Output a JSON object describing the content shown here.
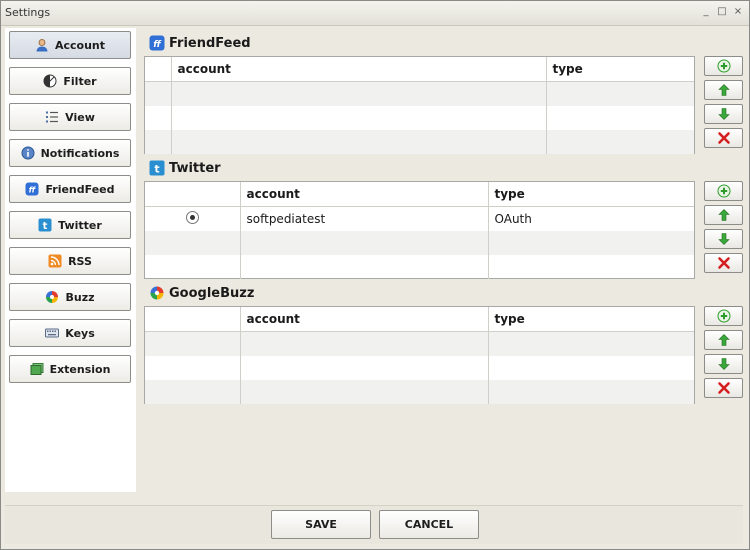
{
  "window": {
    "title": "Settings",
    "minimize": "_",
    "maximize": "□",
    "close": "×"
  },
  "sidebar": {
    "items": [
      {
        "label": "Account",
        "icon": "user-icon",
        "active": true
      },
      {
        "label": "Filter",
        "icon": "filter-icon"
      },
      {
        "label": "View",
        "icon": "list-icon"
      },
      {
        "label": "Notifications",
        "icon": "info-icon"
      },
      {
        "label": "FriendFeed",
        "icon": "friendfeed-icon"
      },
      {
        "label": "Twitter",
        "icon": "twitter-icon"
      },
      {
        "label": "RSS",
        "icon": "rss-icon"
      },
      {
        "label": "Buzz",
        "icon": "buzz-icon"
      },
      {
        "label": "Keys",
        "icon": "keyboard-icon"
      },
      {
        "label": "Extension",
        "icon": "extension-icon"
      }
    ]
  },
  "sections": {
    "friendfeed": {
      "title": "FriendFeed",
      "columns": [
        "",
        "account",
        "type"
      ],
      "rows": []
    },
    "twitter": {
      "title": "Twitter",
      "columns": [
        "",
        "account",
        "type"
      ],
      "rows": [
        {
          "account": "softpediatest",
          "type": "OAuth"
        }
      ]
    },
    "googlebuzz": {
      "title": "GoogleBuzz",
      "columns": [
        "",
        "account",
        "type"
      ],
      "rows": []
    }
  },
  "footer": {
    "save_label": "SAVE",
    "cancel_label": "CANCEL"
  },
  "colors": {
    "add": "#2e9a2e",
    "arrow": "#2e9a2e",
    "delete": "#d42020",
    "friendfeed": "#2f6fd6",
    "twitter": "#2a8fd0"
  }
}
